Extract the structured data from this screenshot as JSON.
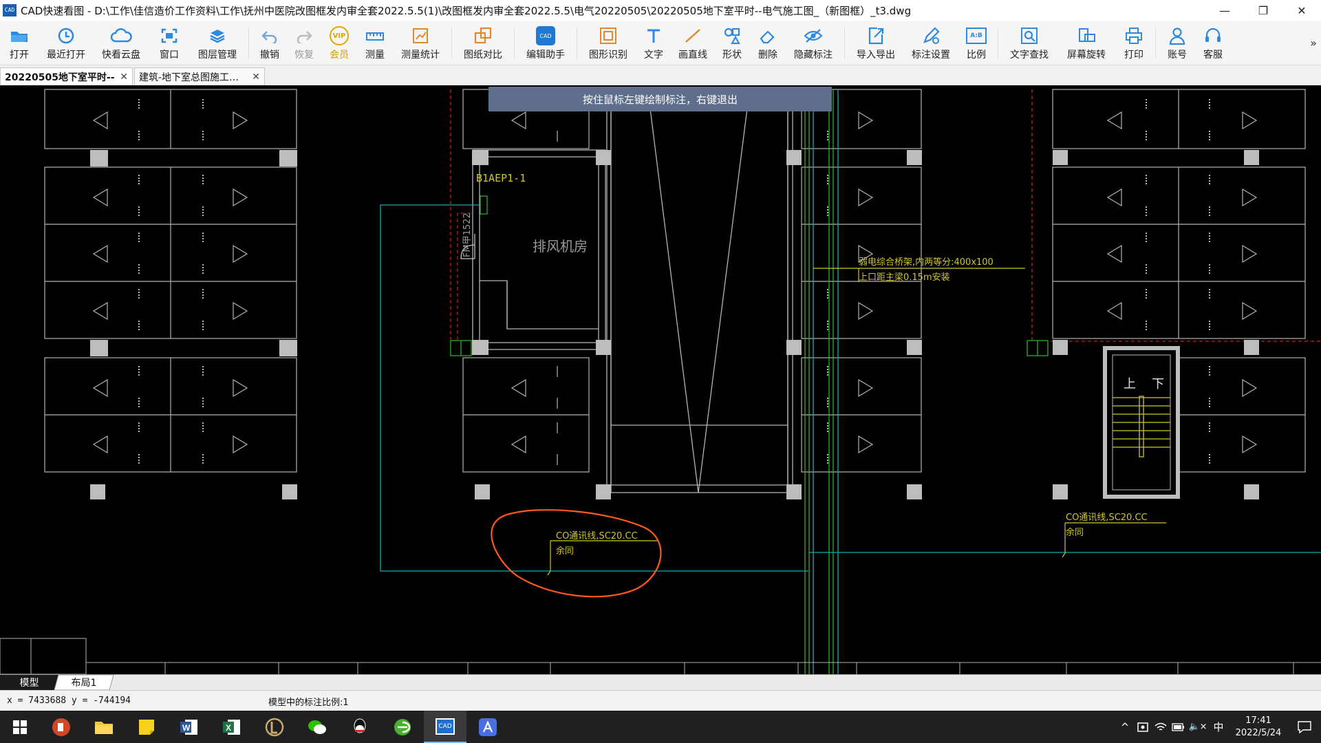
{
  "window": {
    "title": "CAD快速看图 - D:\\工作\\佳信造价工作资料\\工作\\抚州中医院改图框发内审全套2022.5.5(1)\\改图框发内审全套2022.5.5\\电气20220505\\20220505地下室平时--电气施工图_（新图框）_t3.dwg",
    "app_icon_text": "CAD",
    "minimize": "—",
    "maximize": "❐",
    "close": "✕"
  },
  "toolbar": {
    "items": [
      {
        "label": "打开",
        "icon": "folder-open-icon"
      },
      {
        "label": "最近打开",
        "icon": "recent-icon"
      },
      {
        "label": "快看云盘",
        "icon": "cloud-icon"
      },
      {
        "label": "窗口",
        "icon": "window-icon"
      },
      {
        "label": "图层管理",
        "icon": "layers-icon"
      },
      {
        "label": "撤销",
        "icon": "undo-icon"
      },
      {
        "label": "恢复",
        "icon": "redo-icon"
      },
      {
        "label": "会员",
        "icon": "vip-icon"
      },
      {
        "label": "测量",
        "icon": "ruler-icon"
      },
      {
        "label": "测量统计",
        "icon": "measure-stats-icon"
      },
      {
        "label": "图纸对比",
        "icon": "compare-icon"
      },
      {
        "label": "编辑助手",
        "icon": "edit-assistant-icon"
      },
      {
        "label": "图形识别",
        "icon": "shape-recognize-icon"
      },
      {
        "label": "文字",
        "icon": "text-icon"
      },
      {
        "label": "画直线",
        "icon": "line-icon"
      },
      {
        "label": "形状",
        "icon": "shape-icon"
      },
      {
        "label": "删除",
        "icon": "eraser-icon"
      },
      {
        "label": "隐藏标注",
        "icon": "hide-annotation-icon"
      },
      {
        "label": "导入导出",
        "icon": "import-export-icon"
      },
      {
        "label": "标注设置",
        "icon": "annotation-settings-icon"
      },
      {
        "label": "比例",
        "icon": "scale-icon"
      },
      {
        "label": "文字查找",
        "icon": "text-search-icon"
      },
      {
        "label": "屏幕旋转",
        "icon": "rotate-screen-icon"
      },
      {
        "label": "打印",
        "icon": "print-icon"
      },
      {
        "label": "账号",
        "icon": "account-icon"
      },
      {
        "label": "客服",
        "icon": "headset-icon"
      }
    ],
    "vip_badge": "VIP",
    "scale_badge": "A:B",
    "edit_badge": "CAD",
    "more": "»"
  },
  "tabs": [
    {
      "label": "20220505地下室平时--",
      "close": "✕"
    },
    {
      "label": "建筑-地下室总图施工…",
      "close": "✕"
    }
  ],
  "hint": "按住鼠标左键绘制标注，右键退出",
  "drawing": {
    "panel_label": "B1AEP1-1",
    "room_label": "排风机房",
    "door_label": "FM甲1522",
    "tray_label_1": "弱电综合桥架,内两等分:400x100",
    "tray_label_2": "上口距主梁0.15m安装",
    "co_label_1": "CO通讯线,SC20.CC",
    "co_label_2": "余同",
    "stair_up": "上",
    "stair_down": "下"
  },
  "layout_tabs": [
    "模型",
    "布局1"
  ],
  "status": {
    "coords": "x = 7433688  y = -744194",
    "scale": "模型中的标注比例:1"
  },
  "taskbar": {
    "apps": [
      "start-icon",
      "powerpoint-icon",
      "explorer-icon",
      "sticky-notes-icon",
      "word-icon",
      "excel-icon",
      "lol-icon",
      "wechat-icon",
      "qq-icon",
      "browser-icon",
      "cad-viewer-icon",
      "draw-app-icon"
    ],
    "cad_label": "CAD",
    "clock_time": "17:41",
    "clock_date": "2022/5/24",
    "ime": "中",
    "tray_up": "^",
    "volume": "🔈×"
  }
}
